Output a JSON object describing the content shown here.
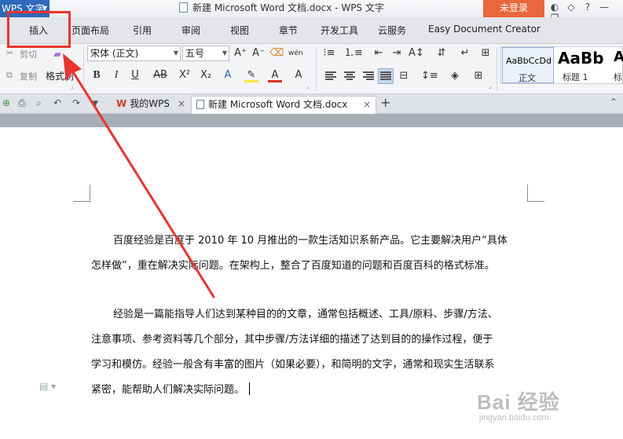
{
  "titlebar": {
    "app_menu": "WPS 文字",
    "document_title": "新建 Microsoft Word 文档.docx - WPS 文字",
    "login_button": "未登录"
  },
  "ribbon_tabs": [
    "插入",
    "页面布局",
    "引用",
    "审阅",
    "视图",
    "章节",
    "开发工具",
    "云服务",
    "Easy Document Creator"
  ],
  "ribbon": {
    "cut_label": "剪切",
    "copy_label": "复制",
    "format_painter_label": "格式刷",
    "font_name": "宋体 (正文)",
    "font_size": "五号",
    "styles": [
      {
        "preview": "AaBbCcDd",
        "name": "正文"
      },
      {
        "preview": "AaBb",
        "name": "标题 1"
      },
      {
        "preview": "A",
        "name": "标"
      }
    ]
  },
  "doc_tabs": [
    {
      "label": "我的WPS",
      "close": "×"
    },
    {
      "label": "新建 Microsoft Word 文档.docx",
      "close": "×"
    }
  ],
  "document": {
    "paragraph1": {
      "first": "百度经验是百度于 2010 年 10 月推出的一款生活知识系新产品。它主要解决用户“具体",
      "rest": "怎样做”，重在解决实际问题。在架构上，整合了百度知道的问题和百度百科的格式标准。"
    },
    "paragraph2": {
      "first": "经验是一篇能指导人们达到某种目的的文章，通常包括概述、工具/原料、步骤/方法、",
      "line2": "注意事项、参考资料等几个部分，其中步骤/方法详细的描述了达到目的的操作过程，便于",
      "line3": "学习和模仿。经验一般含有丰富的图片（如果必要），和简明的文字，通常和现实生活联系",
      "line4": "紧密，能帮助人们解决实际问题。"
    }
  },
  "watermark": {
    "brand": "Bai 经验",
    "url": "jingyan.baidu.com"
  },
  "colors": {
    "accent": "#2f69b9",
    "login": "#e9673d",
    "annotation": "#e8352d"
  }
}
